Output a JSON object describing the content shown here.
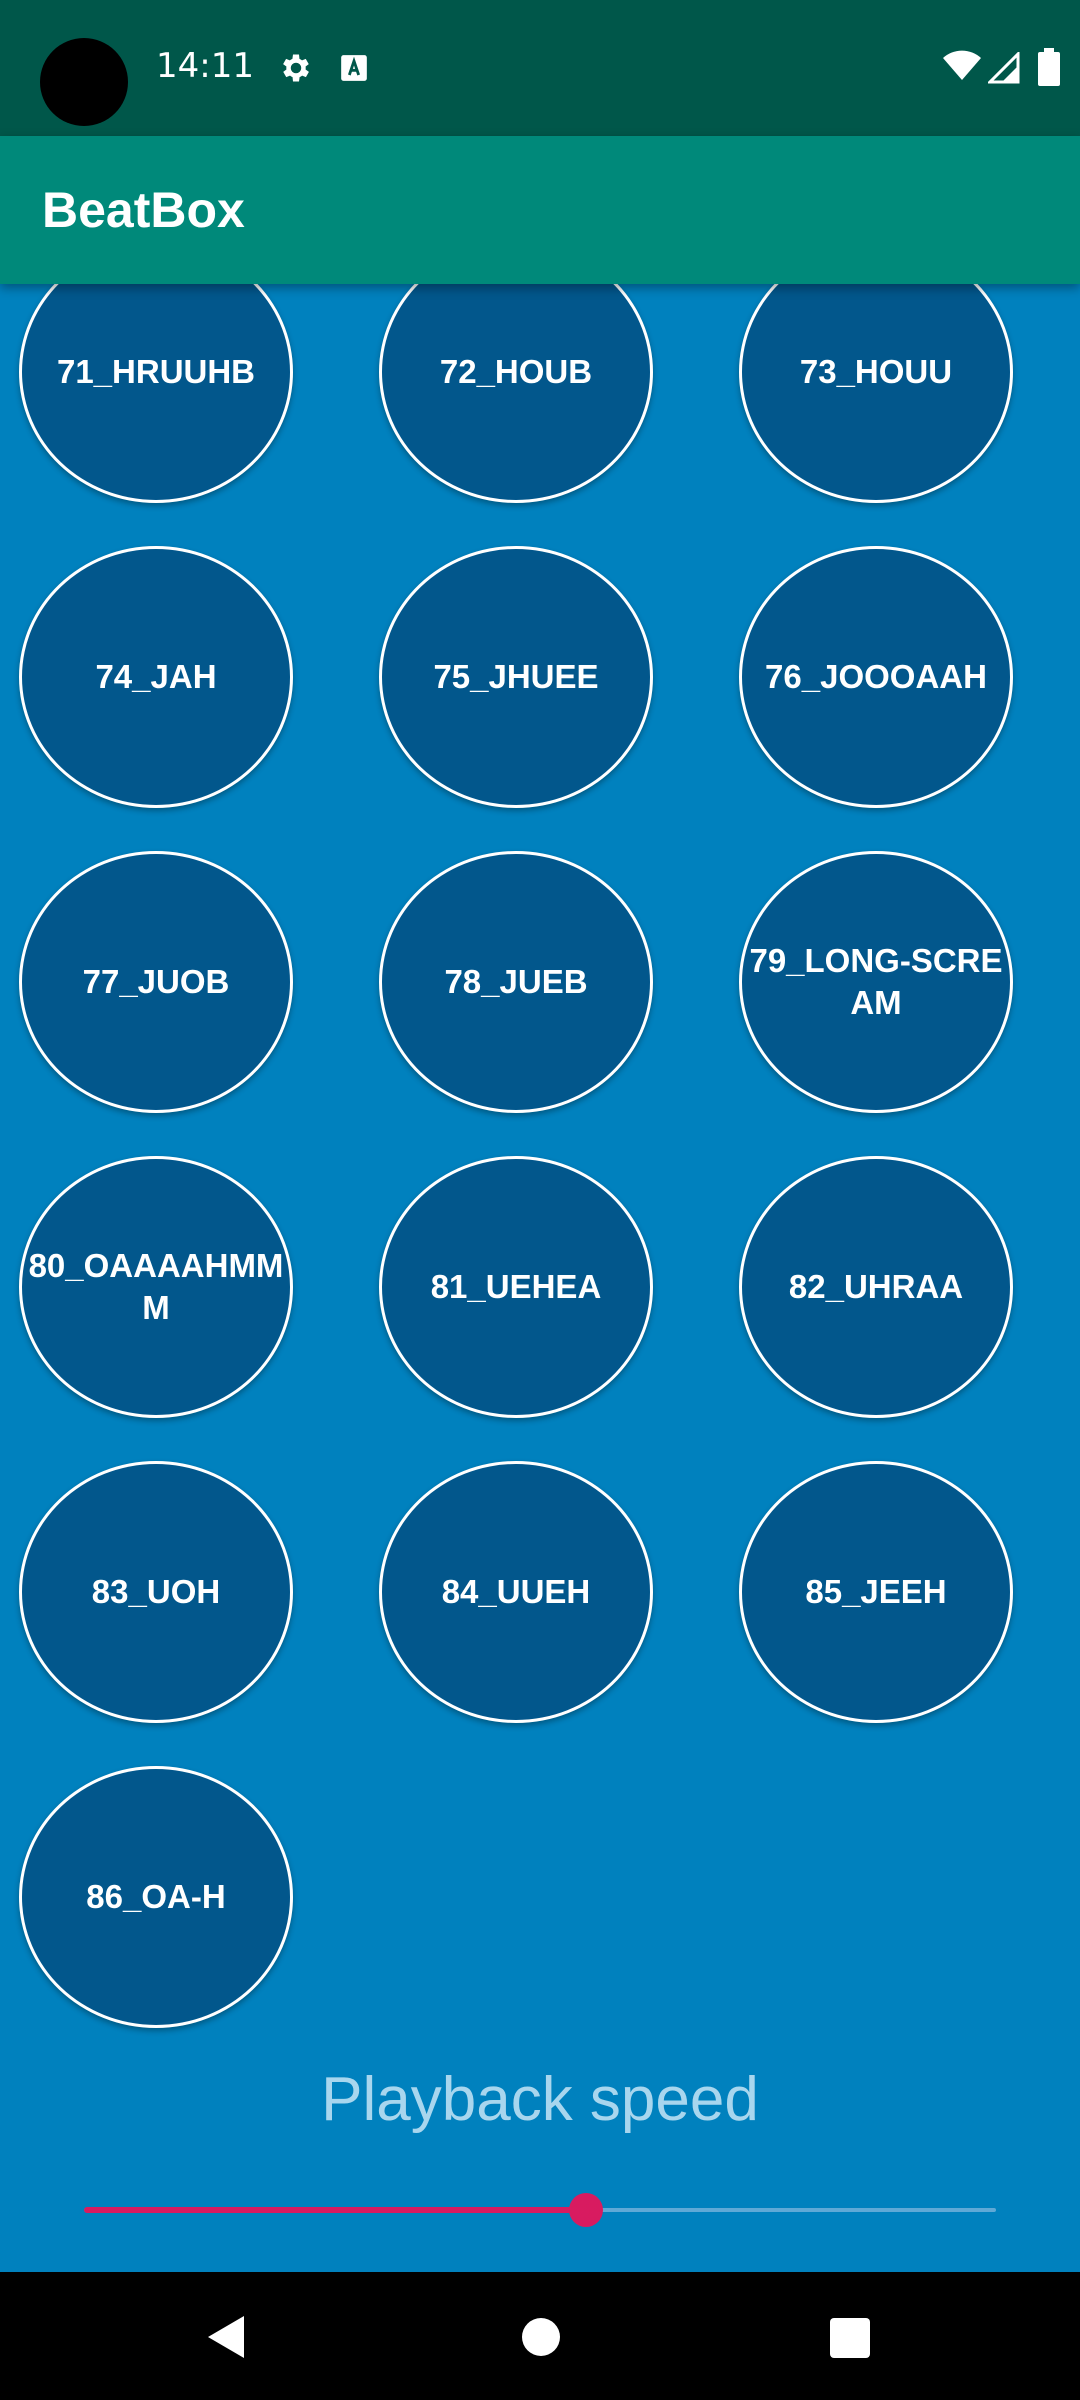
{
  "status_bar": {
    "time": "14:11",
    "icons": [
      "gear-icon",
      "text-a-icon",
      "wifi-icon",
      "signal-icon",
      "battery-icon"
    ]
  },
  "app_bar": {
    "title": "BeatBox"
  },
  "sounds": [
    "71_HRUUHB",
    "72_HOUB",
    "73_HOUU",
    "74_JAH",
    "75_JHUEE",
    "76_JOOOAAH",
    "77_JUOB",
    "78_JUEB",
    "79_LONG-SCREAM",
    "80_OAAAAHMMM",
    "81_UEHEA",
    "82_UHRAA",
    "83_UOH",
    "84_UUEH",
    "85_JEEH",
    "86_OA-H"
  ],
  "playback": {
    "label": "Playback speed",
    "value_fraction": 0.55
  },
  "colors": {
    "status_bar": "#00574A",
    "app_bar": "#00897A",
    "background": "#0081BE",
    "sound_button": "#02578C",
    "slider_accent": "#D81B60"
  },
  "nav_bar": {
    "icons": [
      "back-icon",
      "home-icon",
      "recents-icon"
    ]
  }
}
